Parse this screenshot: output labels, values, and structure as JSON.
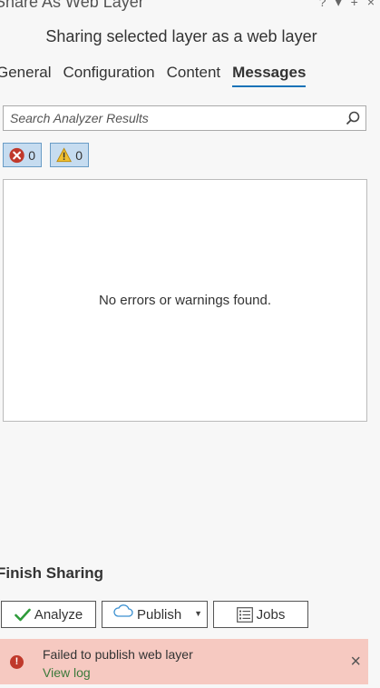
{
  "window": {
    "title": "Share As Web Layer",
    "controls": [
      "?",
      "▾",
      "+",
      "×"
    ]
  },
  "subtitle": "Sharing selected layer as a web layer",
  "tabs": [
    {
      "label": "General",
      "active": false
    },
    {
      "label": "Configuration",
      "active": false
    },
    {
      "label": "Content",
      "active": false
    },
    {
      "label": "Messages",
      "active": true
    }
  ],
  "search": {
    "placeholder": "Search Analyzer Results"
  },
  "filters": {
    "errors_count": "0",
    "warnings_count": "0"
  },
  "results": {
    "empty_message": "No errors or warnings found."
  },
  "finish": {
    "heading": "Finish Sharing",
    "analyze_label": "Analyze",
    "publish_label": "Publish",
    "jobs_label": "Jobs"
  },
  "banner": {
    "message": "Failed to publish web layer",
    "link": "View log"
  },
  "colors": {
    "accent": "#1a73b8",
    "error": "#c0392b",
    "warning": "#e0a800",
    "banner_bg": "#f6c9c1",
    "check": "#2e9b3a"
  }
}
